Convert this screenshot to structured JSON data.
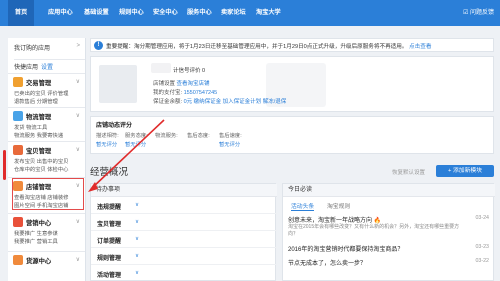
{
  "topnav": {
    "items": [
      "首页",
      "应用中心",
      "基础设置",
      "规则中心",
      "安全中心",
      "服务中心",
      "卖家论坛",
      "淘宝大学"
    ],
    "feedback": "☑ 问题反馈"
  },
  "sidebar": {
    "apps_label": "我订购的应用",
    "quick_label": "快捷应用",
    "quick_link": "设置",
    "groups": [
      {
        "title": "交易管理",
        "icon_color": "#f0a030",
        "lines": [
          "已卖出的宝贝 评价管理",
          "退款售后   分期管理"
        ]
      },
      {
        "title": "物流管理",
        "icon_color": "#49a3e8",
        "lines": [
          "发货        物流工具",
          "物流服务    我要寄快递"
        ]
      },
      {
        "title": "宝贝管理",
        "icon_color": "#e86a3a",
        "lines": [
          "发布宝贝    出售中的宝贝",
          "仓库中的宝贝 体检中心"
        ]
      },
      {
        "title": "店铺管理",
        "icon_color": "#f08a3c",
        "lines": [
          "查看淘宝店铺 店铺装修",
          "图片空间    手机淘宝店铺"
        ]
      },
      {
        "title": "营销中心",
        "icon_color": "#e9513a",
        "lines": [
          "我要推广    生意参谋",
          "我要推广    营销工具"
        ]
      },
      {
        "title": "货源中心",
        "icon_color": "#f08a3c",
        "lines": []
      }
    ]
  },
  "notice": {
    "icon": "!",
    "text": "重要提醒：淘分期管理应用，将于1月23日迁移至基础管理应用中，并于1月29日0点正式升级，升级后原服务将不再适用。",
    "link": "点击查看"
  },
  "shop": {
    "rating_label": "计信号评价 0",
    "lines": [
      {
        "label": "店铺设置",
        "value": "查看淘宝店铺"
      },
      {
        "label": "我的支付宝:",
        "value": "15507547245"
      },
      {
        "label": "保证金余额:",
        "value": "0元 缴纳保证金 加入保证金计划  解冻/退保"
      }
    ]
  },
  "dynamic": {
    "title": "店铺动态评分",
    "cells": [
      {
        "label": "描述相符:",
        "value": "暂无评分"
      },
      {
        "label": "服务态度:",
        "value": ""
      },
      {
        "label": "物流服务:",
        "value": ""
      },
      {
        "label": "售后态度:",
        "value": ""
      },
      {
        "label": "售后速度:",
        "value": "暂无评分"
      },
      {
        "label": "暂无评分",
        "value": ""
      }
    ]
  },
  "overview": {
    "title": "经营概况",
    "recover": "恢复默认设置",
    "add_button": "+ 添加新模块"
  },
  "modules": {
    "header": "待办事项",
    "rows": [
      "违规提醒",
      "宝贝管理",
      "订单提醒",
      "规则管理",
      "活动管理"
    ]
  },
  "today": {
    "header": "今日必读",
    "tabs": [
      "活动头条",
      "淘宝规则"
    ],
    "items": [
      {
        "title": "创意未来，淘宝新一年战略方向",
        "hot": "🔥",
        "date": "03-24",
        "excerpt": "淘宝在2015年会有哪些改变？又有什么新的机会？另外，淘宝还有哪些重要方向？"
      },
      {
        "title": "2016年的淘宝营销时代都要保持淘宝商品？",
        "hot": "",
        "date": "03-23",
        "excerpt": ""
      },
      {
        "title": "节点无成本了，怎么卖一步？",
        "hot": "",
        "date": "03-22",
        "excerpt": ""
      }
    ]
  },
  "colors": {
    "brand": "#2b7fd8",
    "nav_active": "#1f66b8",
    "highlight": "#e34b4b"
  }
}
